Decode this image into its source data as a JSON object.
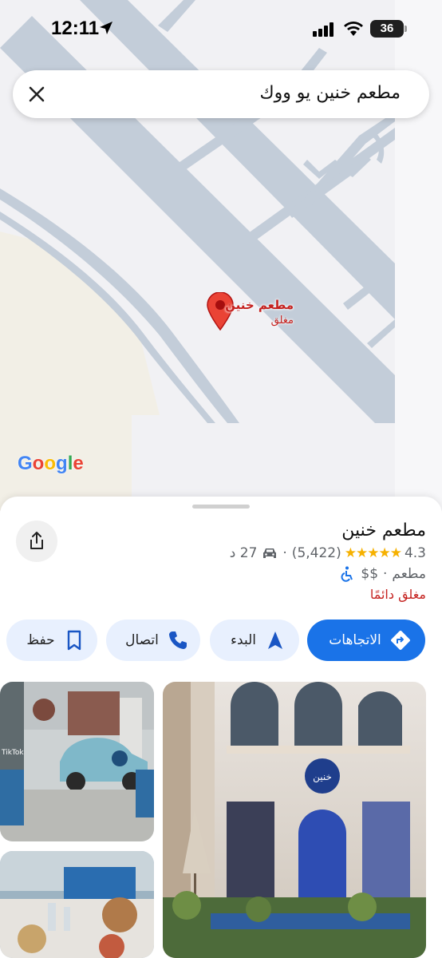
{
  "status_bar": {
    "time": "12:11",
    "battery": "36"
  },
  "search": {
    "query": "مطعم خنين يو ووك"
  },
  "map": {
    "pin": {
      "name": "مطعم خنين",
      "status": "مغلق"
    },
    "logo": "Google"
  },
  "place": {
    "name": "مطعم خنين",
    "rating": "4.3",
    "stars": "★★★★★",
    "reviews": "(5,422)",
    "drive_time": "27 د",
    "category": "مطعم",
    "price": "$$",
    "status": "مغلق دائمًا"
  },
  "actions": {
    "directions": "الاتجاهات",
    "start": "البدء",
    "call": "اتصال",
    "save": "حفظ"
  },
  "photos": {
    "tiktok_watermark": "TikTok"
  },
  "colors": {
    "accent": "#1a73e8",
    "closed_red": "#c5221f",
    "star": "#f6b100",
    "road": "#c3cdd9"
  }
}
